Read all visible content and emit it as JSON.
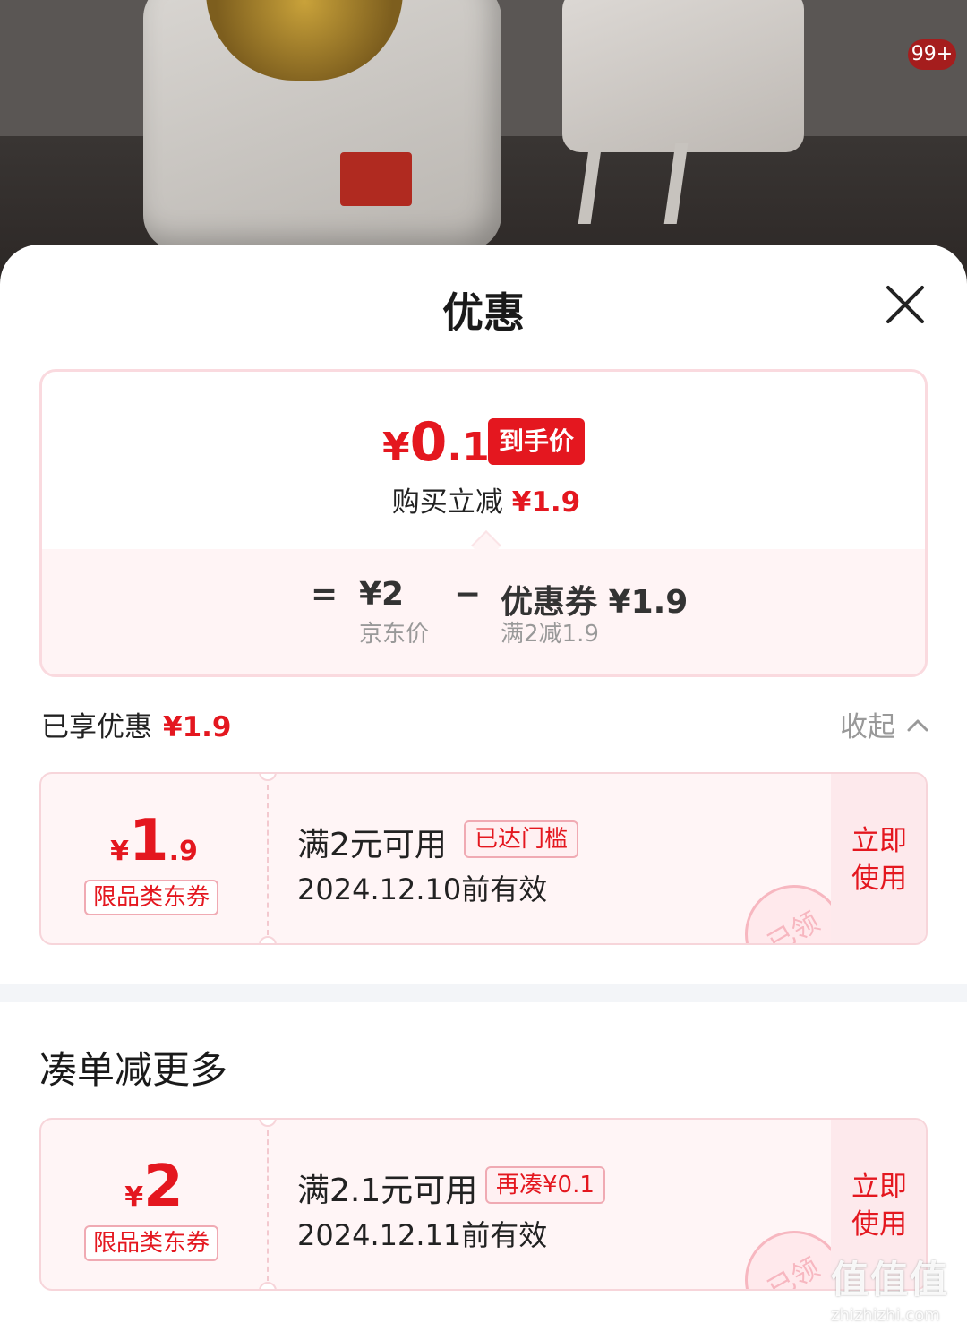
{
  "background": {
    "cart_badge": "99+"
  },
  "sheet": {
    "title": "优惠",
    "close_icon": "close-icon"
  },
  "price_summary": {
    "final_price": {
      "currency": "¥",
      "integer": "0",
      "decimal": ".1"
    },
    "final_price_tag": "到手价",
    "buy_discount_label": "购买立减",
    "buy_discount_value": "¥1.9",
    "equals_sign": "=",
    "jd_price": "¥2",
    "jd_price_label": "京东价",
    "minus_sign": "−",
    "coupon_label": "优惠券 ¥1.9",
    "coupon_rule": "满2减1.9"
  },
  "enjoyed": {
    "label": "已享优惠",
    "value": "¥1.9",
    "collapse_label": "收起"
  },
  "coupons_enjoyed": [
    {
      "amount": {
        "currency": "¥",
        "integer": "1",
        "decimal": ".9"
      },
      "kind": "限品类东券",
      "condition": "满2元可用",
      "status_tag": "已达门槛",
      "valid_until": "2024.12.10前有效",
      "action_line1": "立即",
      "action_line2": "使用",
      "stamp": "已领"
    }
  ],
  "more_section": {
    "title": "凑单减更多"
  },
  "coupons_more": [
    {
      "amount": {
        "currency": "¥",
        "integer": "2",
        "decimal": ""
      },
      "kind": "限品类东券",
      "condition": "满2.1元可用",
      "status_tag": "再凑¥0.1",
      "valid_until": "2024.12.11前有效",
      "action_line1": "立即",
      "action_line2": "使用",
      "stamp": "已领"
    }
  ],
  "watermark": {
    "big": "值值值",
    "small": "zhizhizhi.com"
  }
}
